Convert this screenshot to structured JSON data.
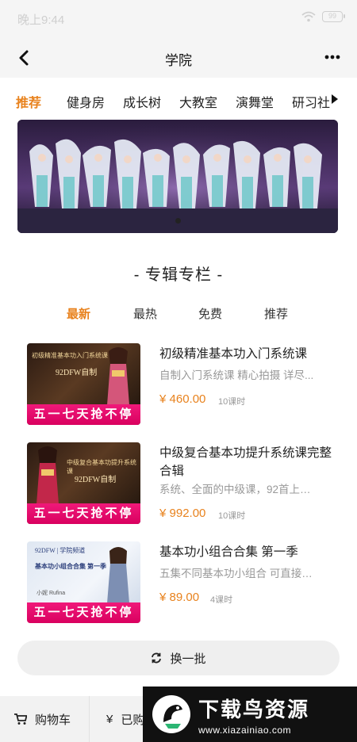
{
  "status_bar": {
    "time": "晚上9:44",
    "battery": "99"
  },
  "nav": {
    "title": "学院"
  },
  "category_tabs": [
    "推荐",
    "健身房",
    "成长树",
    "大教室",
    "演舞堂",
    "研习社"
  ],
  "section": {
    "title": "- 专辑专栏 -"
  },
  "sort_tabs": [
    "最新",
    "最热",
    "免费",
    "推荐"
  ],
  "courses": [
    {
      "title": "初级精准基本功入门系统课",
      "description": "自制入门系统课 精心拍摄 详尽...",
      "price": "¥ 460.00",
      "lessons": "10课时",
      "thumb_caption": "初级精准基本功入门系统课",
      "thumb_caption2": "92DFW自制",
      "thumb_band": "五一七天抢不停"
    },
    {
      "title": "中级复合基本功提升系统课完整合辑",
      "description": "系统、全面的中级课，92首上尝...",
      "price": "¥ 992.00",
      "lessons": "10课时",
      "thumb_caption": "中级复合基本功提升系统课",
      "thumb_caption2": "92DFW自制",
      "thumb_band": "五一七天抢不停"
    },
    {
      "title": "基本功小组合合集 第一季",
      "description": "五集不同基本功小组合 可直接教...",
      "price": "¥ 89.00",
      "lessons": "4课时",
      "thumb_caption": "基本功小组合合集 第一季",
      "thumb_caption2": "92DFW | 学院频道",
      "thumb_caption3": "小妮 Rufina",
      "thumb_band": "五一七天抢不停"
    }
  ],
  "refresh_button": {
    "label": "换一批"
  },
  "bottom_bar": {
    "cart_label": "购物车",
    "purchased_label": "已购"
  },
  "watermark": {
    "title": "下载鸟资源",
    "url": "www.xiazainiao.com"
  },
  "colors": {
    "accent": "#e8821d",
    "promo_band": "#e8006a",
    "background": "#ffffff",
    "nav_bg": "#f5f5f5"
  }
}
